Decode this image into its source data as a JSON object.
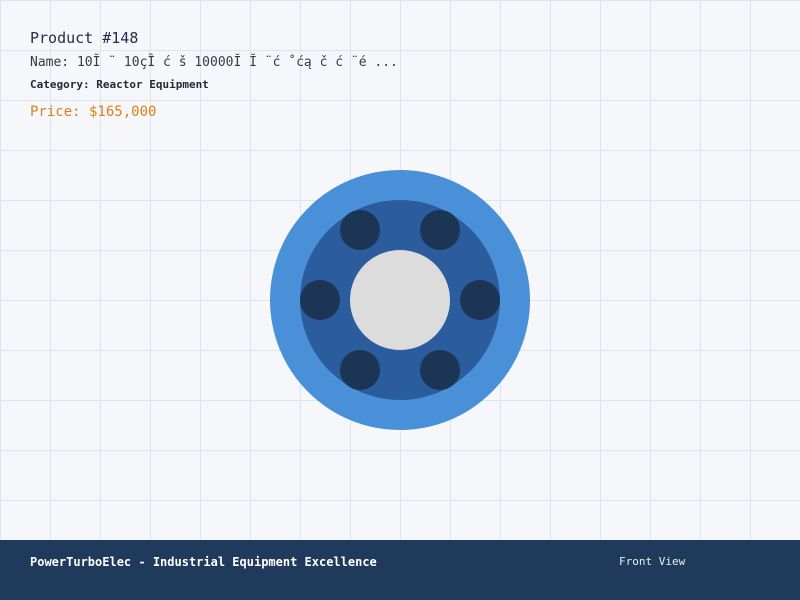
{
  "product": {
    "title": "Product #148",
    "name": "Name: 10Ĭ ¨ 10çȈ ć š 10000Ĭ  Ĭ ¨ć ˚ćą č  ć ¨é ...",
    "category": "Category: Reactor Equipment",
    "price": "Price: $165,000"
  },
  "footer": {
    "brand": "PowerTurboElec - Industrial Equipment Excellence",
    "view": "Front View"
  },
  "colors": {
    "background": "#f5f7fa",
    "grid": "#dfe3ea",
    "outer_ring": "#4a90d9",
    "inner_disc": "#2b5c9e",
    "bolt_holes": "#1c3555",
    "center_bore": "#dcdcdc",
    "price": "#e07f15",
    "footer": "#1f3a5a"
  }
}
